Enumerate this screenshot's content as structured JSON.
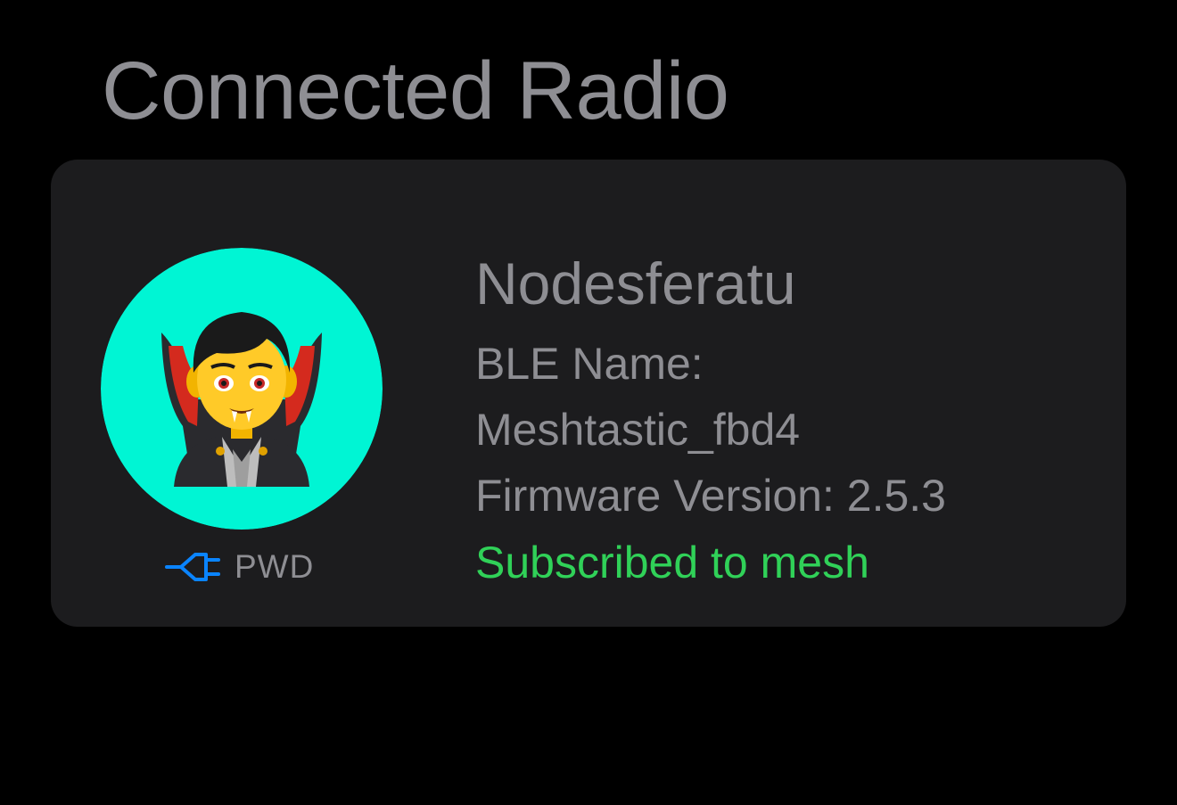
{
  "section": {
    "title": "Connected Radio"
  },
  "node": {
    "avatar_icon": "vampire-emoji",
    "avatar_bg": "#00f5d4",
    "name": "Nodesferatu",
    "ble_label": "BLE Name:",
    "ble_value": "Meshtastic_fbd4",
    "firmware": "Firmware Version: 2.5.3",
    "status": "Subscribed to mesh",
    "status_color": "#30d158",
    "power": {
      "icon": "plug-icon",
      "label": "PWD",
      "icon_color": "#0a84ff"
    }
  }
}
